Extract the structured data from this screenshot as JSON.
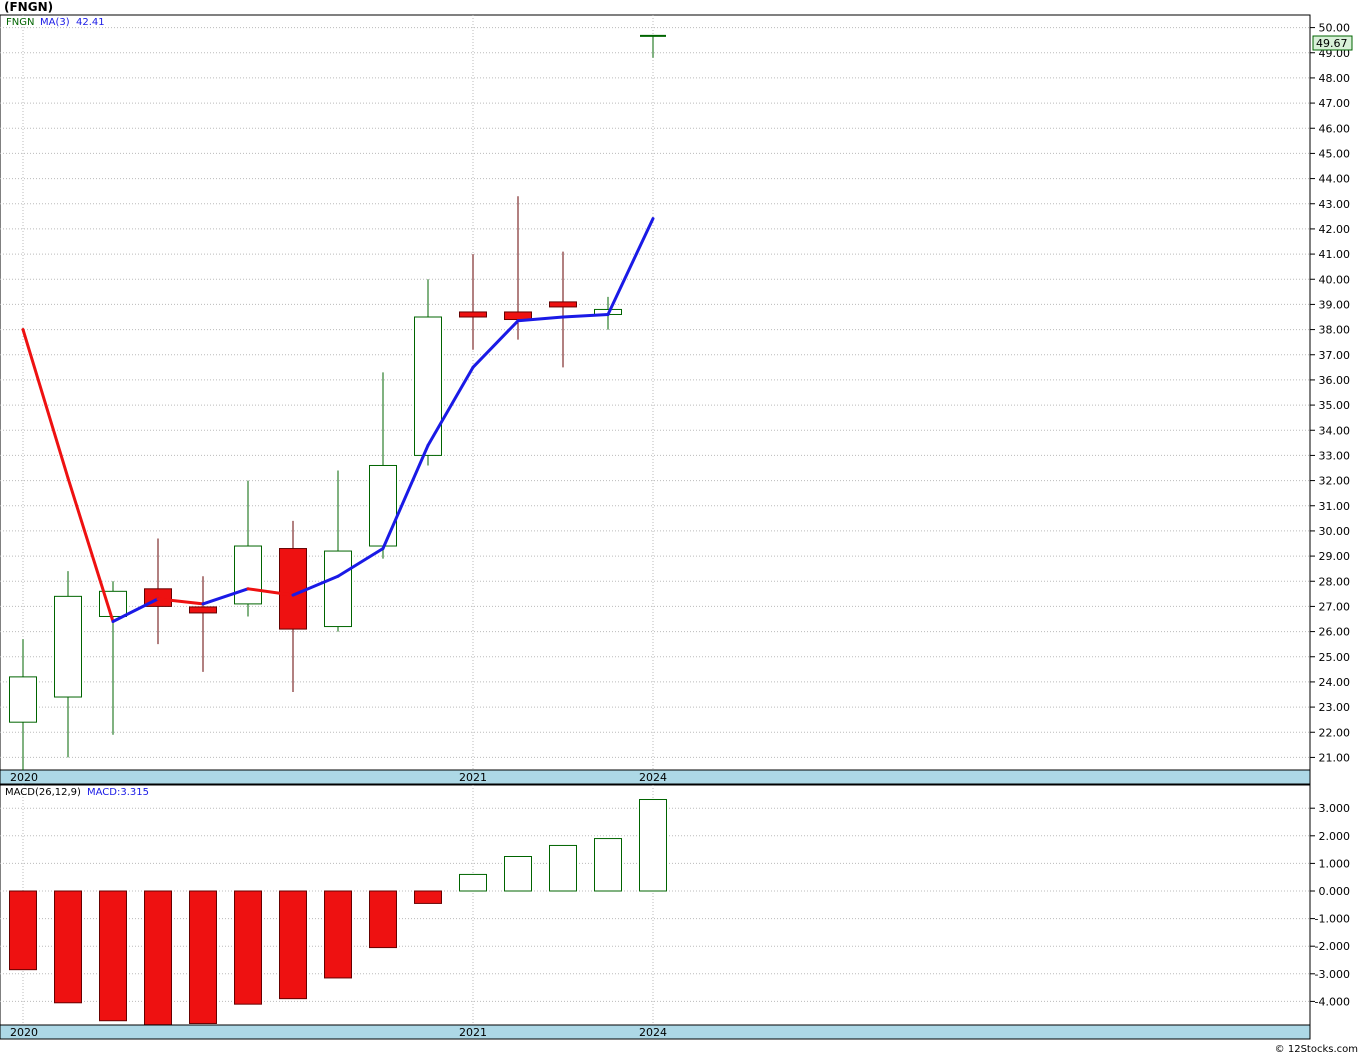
{
  "title": "(FNGN)",
  "copyright": "© 12Stocks.com",
  "price_panel": {
    "ticker_label": "FNGN",
    "ma_label": "MA(3)",
    "ma_value": "42.41",
    "last_price": "49.67"
  },
  "macd_panel": {
    "label": "MACD(26,12,9)",
    "value_label": "MACD:3.315"
  },
  "colors": {
    "up": "#006400",
    "down_fill": "#ee1111",
    "down_wick": "#660000",
    "ma_up": "#1a1ae6",
    "ma_down": "#ee1111",
    "axis_band": "#add8e6",
    "grid": "#bbbbbb",
    "last_price_bg": "#d8f0d8"
  },
  "chart_data": [
    {
      "type": "candlestick",
      "title": "(FNGN)",
      "x_labels": [
        {
          "index": 0,
          "label": "2020"
        },
        {
          "index": 10,
          "label": "2021"
        },
        {
          "index": 14,
          "label": "2024"
        }
      ],
      "ylim": [
        20.5,
        50.5
      ],
      "y_ticks": [
        "21.00",
        "22.00",
        "23.00",
        "24.00",
        "25.00",
        "26.00",
        "27.00",
        "28.00",
        "29.00",
        "30.00",
        "31.00",
        "32.00",
        "33.00",
        "34.00",
        "35.00",
        "36.00",
        "37.00",
        "38.00",
        "39.00",
        "40.00",
        "41.00",
        "42.00",
        "43.00",
        "44.00",
        "45.00",
        "46.00",
        "47.00",
        "48.00",
        "49.00",
        "50.00"
      ],
      "grid": true,
      "candles": [
        {
          "open": 22.4,
          "high": 25.7,
          "low": 20.5,
          "close": 24.2
        },
        {
          "open": 23.4,
          "high": 28.4,
          "low": 21.0,
          "close": 27.4
        },
        {
          "open": 26.6,
          "high": 28.0,
          "low": 21.9,
          "close": 27.6
        },
        {
          "open": 27.7,
          "high": 29.7,
          "low": 25.5,
          "close": 27.0
        },
        {
          "open": 26.9,
          "high": 28.2,
          "low": 24.4,
          "close": 26.8
        },
        {
          "open": 27.1,
          "high": 32.0,
          "low": 26.6,
          "close": 29.4
        },
        {
          "open": 29.3,
          "high": 30.4,
          "low": 23.6,
          "close": 26.1
        },
        {
          "open": 26.2,
          "high": 32.4,
          "low": 26.0,
          "close": 29.2
        },
        {
          "open": 29.4,
          "high": 36.3,
          "low": 28.9,
          "close": 32.6
        },
        {
          "open": 33.0,
          "high": 40.0,
          "low": 32.6,
          "close": 38.5
        },
        {
          "open": 38.7,
          "high": 41.0,
          "low": 37.2,
          "close": 38.5
        },
        {
          "open": 38.7,
          "high": 43.3,
          "low": 37.6,
          "close": 38.4
        },
        {
          "open": 39.1,
          "high": 41.1,
          "low": 36.5,
          "close": 38.9
        },
        {
          "open": 38.6,
          "high": 39.3,
          "low": 38.0,
          "close": 38.8
        },
        {
          "open": 49.67,
          "high": 49.67,
          "low": 48.8,
          "close": 49.67
        }
      ],
      "ma3": [
        38.0,
        32.1,
        26.4,
        27.3,
        27.1,
        27.7,
        27.45,
        28.2,
        29.3,
        33.4,
        36.5,
        38.35,
        38.5,
        38.6,
        42.41
      ]
    },
    {
      "type": "bar",
      "title": "MACD(26,12,9)",
      "ylim": [
        -4.9,
        3.7
      ],
      "y_ticks": [
        "-4.000",
        "-3.000",
        "-2.000",
        "-1.000",
        "0.000",
        "1.000",
        "2.000",
        "3.000"
      ],
      "x_labels": [
        {
          "index": 0,
          "label": "2020"
        },
        {
          "index": 10,
          "label": "2021"
        },
        {
          "index": 14,
          "label": "2024"
        }
      ],
      "values": [
        -2.85,
        -4.05,
        -4.7,
        -4.85,
        -4.8,
        -4.1,
        -3.9,
        -3.15,
        -2.05,
        -0.45,
        0.6,
        1.25,
        1.65,
        1.9,
        3.315
      ]
    }
  ]
}
